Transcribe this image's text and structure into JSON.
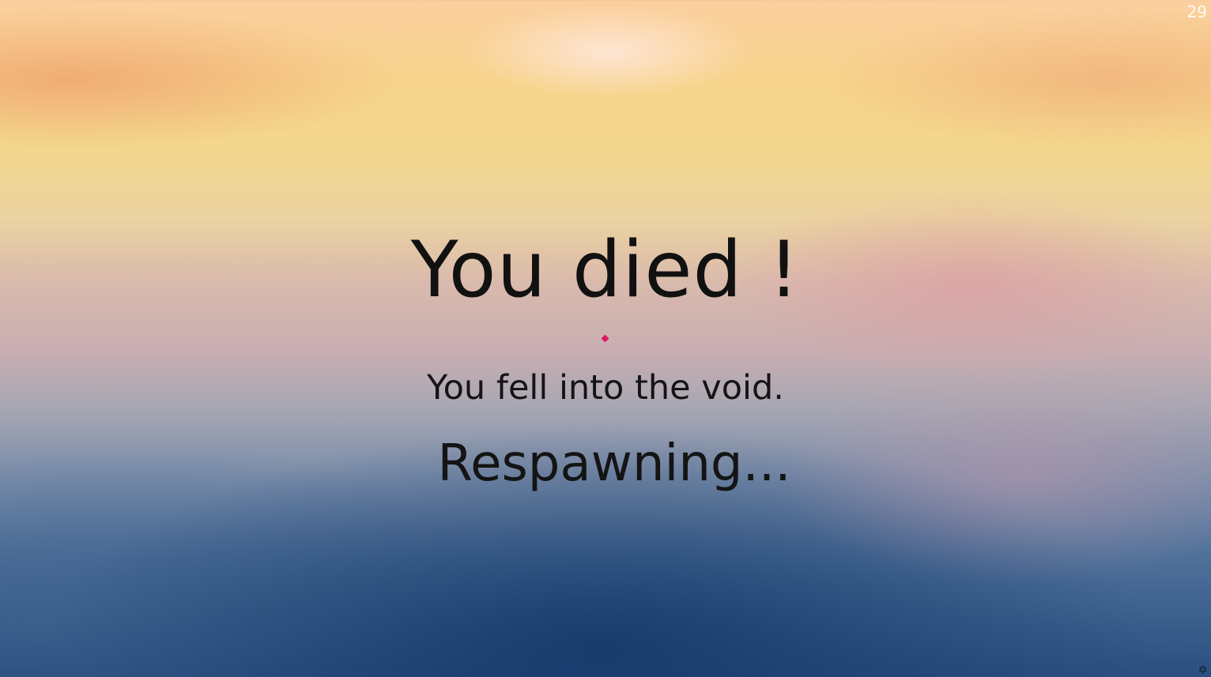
{
  "hud": {
    "fps": "29"
  },
  "death_screen": {
    "title": "You died !",
    "reason": "You fell into the void.",
    "status": "Respawning..."
  },
  "crosshair": {
    "color": "#d81b60"
  },
  "settings": {
    "icon": "gear-icon"
  }
}
